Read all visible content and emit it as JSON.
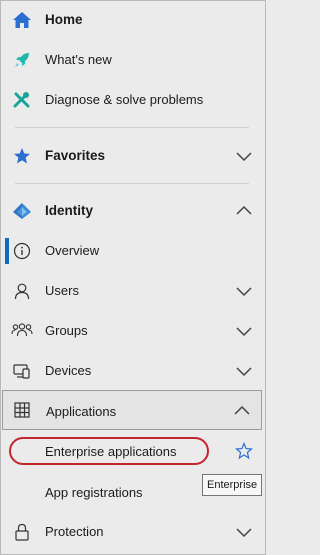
{
  "nav": {
    "home": {
      "label": "Home",
      "icon": "home-icon"
    },
    "whats_new": {
      "label": "What's new",
      "icon": "rocket-icon"
    },
    "diagnose": {
      "label": "Diagnose & solve problems",
      "icon": "wrench-icon"
    },
    "favorites": {
      "label": "Favorites",
      "icon": "star-icon",
      "expanded": false
    },
    "identity": {
      "label": "Identity",
      "icon": "identity-diamond-icon",
      "expanded": true
    },
    "overview": {
      "label": "Overview",
      "icon": "info-icon"
    },
    "users": {
      "label": "Users",
      "icon": "user-icon",
      "expanded": false
    },
    "groups": {
      "label": "Groups",
      "icon": "groups-icon",
      "expanded": false
    },
    "devices": {
      "label": "Devices",
      "icon": "devices-icon",
      "expanded": false
    },
    "applications": {
      "label": "Applications",
      "icon": "applications-icon",
      "expanded": true
    },
    "enterprise_apps": {
      "label": "Enterprise applications",
      "favorite_icon": "star-outline-icon"
    },
    "app_registrations": {
      "label": "App registrations"
    },
    "protection": {
      "label": "Protection",
      "icon": "lock-icon",
      "expanded": false
    }
  },
  "tooltip": {
    "text": "Enterprise"
  },
  "colors": {
    "accent": "#0f6cbd",
    "highlight": "#c4262e",
    "background": "#ebebeb"
  }
}
